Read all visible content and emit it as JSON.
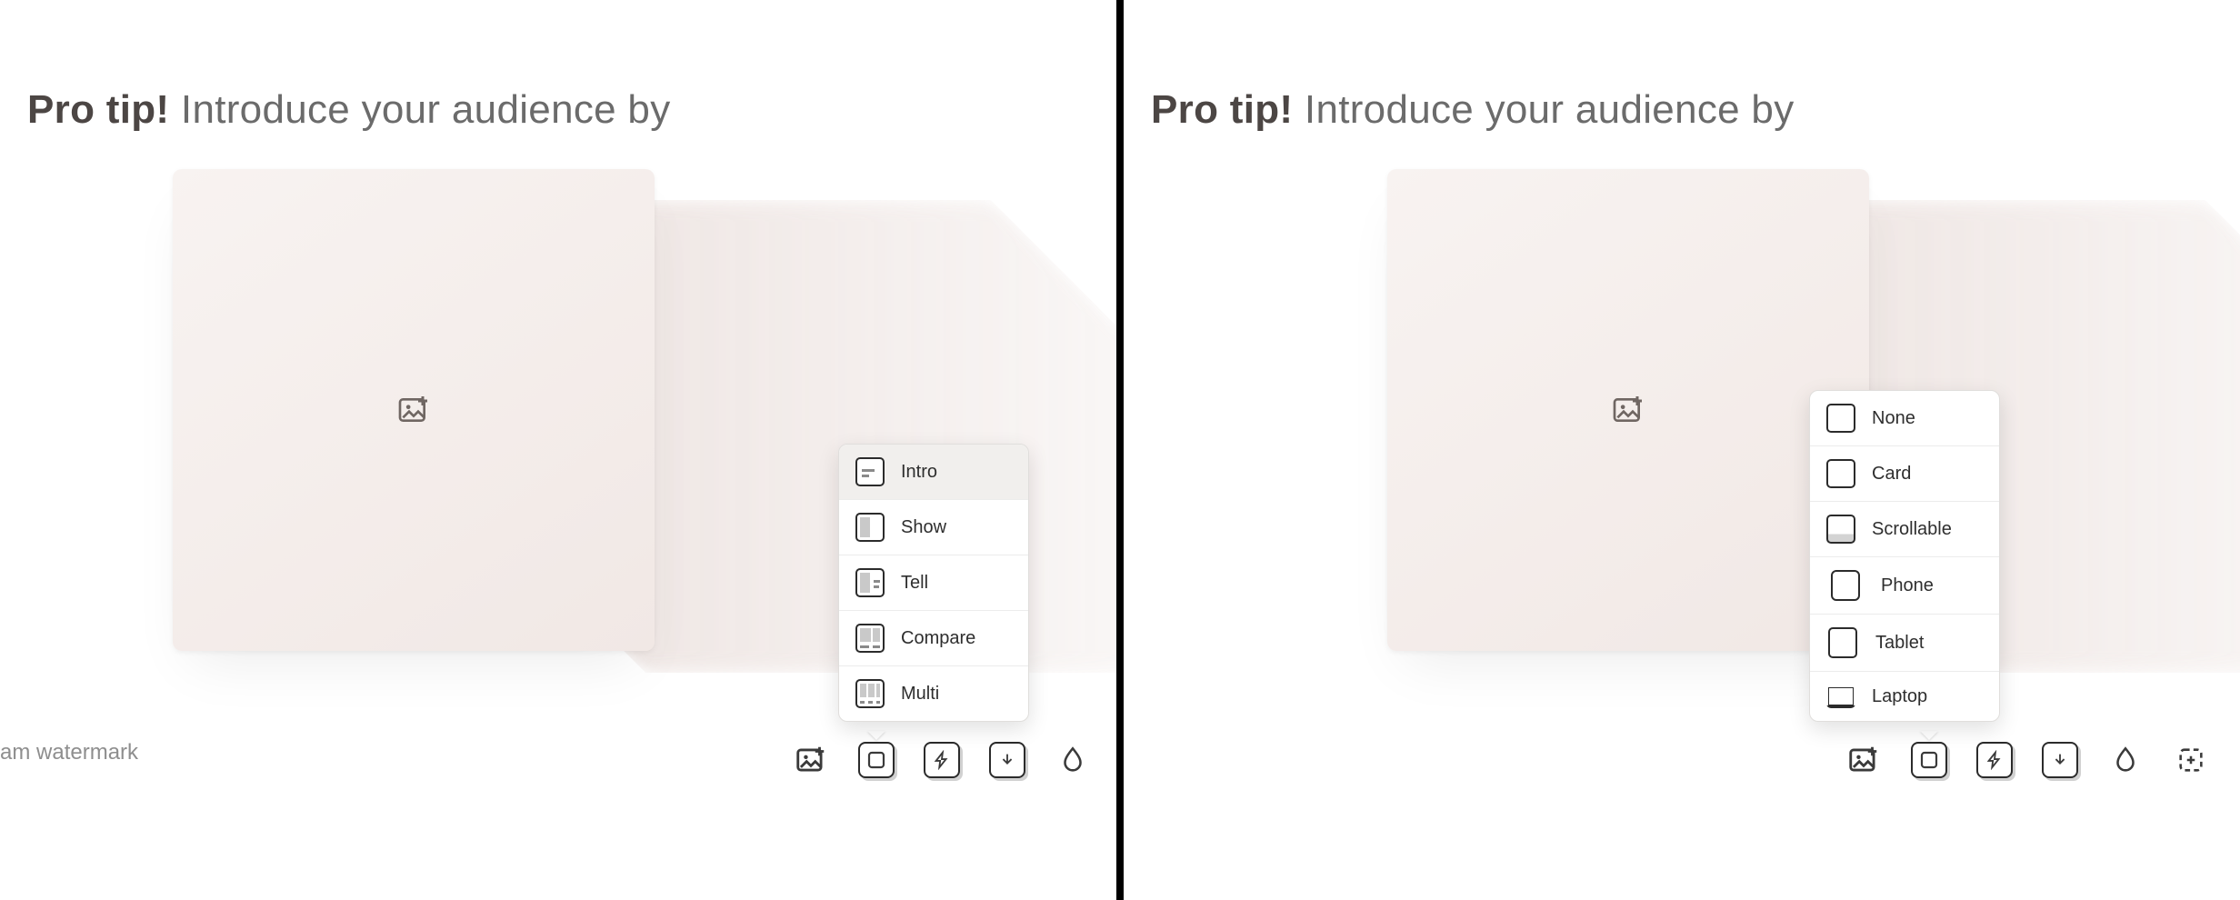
{
  "left": {
    "tip_bold": "Pro tip!",
    "tip_rest": " Introduce your audience by",
    "watermark": "am watermark",
    "menu": {
      "items": [
        {
          "label": "Intro",
          "kind": "intro"
        },
        {
          "label": "Show",
          "kind": "show"
        },
        {
          "label": "Tell",
          "kind": "tell"
        },
        {
          "label": "Compare",
          "kind": "compare"
        },
        {
          "label": "Multi",
          "kind": "multi"
        }
      ],
      "selected_index": 0
    },
    "toolbar": [
      "add-image",
      "frame",
      "action",
      "import",
      "water"
    ]
  },
  "right": {
    "tip_bold": "Pro tip!",
    "tip_rest": " Introduce your audience by",
    "menu": {
      "items": [
        {
          "label": "None",
          "kind": "plain"
        },
        {
          "label": "Card",
          "kind": "plain"
        },
        {
          "label": "Scrollable",
          "kind": "scroll"
        },
        {
          "label": "Phone",
          "kind": "phone"
        },
        {
          "label": "Tablet",
          "kind": "tablet"
        },
        {
          "label": "Laptop",
          "kind": "laptop"
        }
      ],
      "selected_index": -1
    },
    "toolbar": [
      "add-image",
      "frame",
      "action",
      "import",
      "water",
      "crop"
    ]
  }
}
